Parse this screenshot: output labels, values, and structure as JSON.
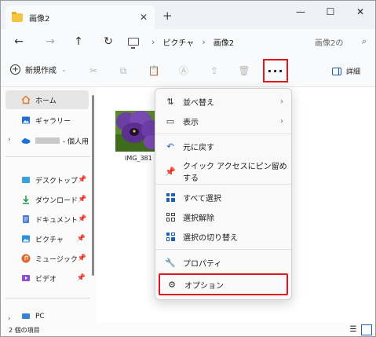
{
  "window": {
    "tab_title": "画像2",
    "tab_close": "✕",
    "new_tab": "+",
    "minimize": "—",
    "maximize": "☐",
    "close": "✕"
  },
  "navbar": {
    "back": "←",
    "forward": "→",
    "up": "↑",
    "refresh": "↻",
    "crumbs": [
      "ピクチャ",
      "画像2"
    ],
    "crumb_sep": "›",
    "search_placeholder": "画像2の",
    "search_icon": "search-icon"
  },
  "toolbar": {
    "new_label": "新規作成",
    "more_label": "···",
    "details_label": "詳細",
    "icons": [
      "cut-icon",
      "copy-icon",
      "paste-icon",
      "rename-icon",
      "share-icon",
      "delete-icon"
    ]
  },
  "sidebar": {
    "items": [
      {
        "label": "ホーム",
        "icon": "home-icon",
        "selected": true
      },
      {
        "label": "ギャラリー",
        "icon": "gallery-icon"
      },
      {
        "label": "- 個人用",
        "icon": "onedrive-icon"
      },
      {
        "label": "デスクトップ",
        "icon": "desktop-icon",
        "pinned": true
      },
      {
        "label": "ダウンロード",
        "icon": "download-icon",
        "pinned": true
      },
      {
        "label": "ドキュメント",
        "icon": "document-icon",
        "pinned": true
      },
      {
        "label": "ピクチャ",
        "icon": "pictures-icon",
        "pinned": true
      },
      {
        "label": "ミュージック",
        "icon": "music-icon",
        "pinned": true
      },
      {
        "label": "ビデオ",
        "icon": "video-icon",
        "pinned": true
      },
      {
        "label": "PC",
        "icon": "pc-icon"
      }
    ]
  },
  "content": {
    "files": [
      {
        "name": "IMG_381",
        "type": "image"
      }
    ]
  },
  "menu": {
    "items": [
      {
        "label": "並べ替え",
        "icon": "sort-icon",
        "submenu": true
      },
      {
        "label": "表示",
        "icon": "view-icon",
        "submenu": true
      },
      {
        "label": "元に戻す",
        "icon": "undo-icon"
      },
      {
        "label": "クイック アクセスにピン留めする",
        "icon": "pin-icon"
      },
      {
        "label": "すべて選択",
        "icon": "select-all-icon"
      },
      {
        "label": "選択解除",
        "icon": "select-none-icon"
      },
      {
        "label": "選択の切り替え",
        "icon": "invert-selection-icon"
      },
      {
        "label": "プロパティ",
        "icon": "properties-icon"
      },
      {
        "label": "オプション",
        "icon": "options-icon",
        "highlighted": true
      }
    ]
  },
  "status": {
    "item_count": "2 個の項目"
  },
  "colors": {
    "highlight_border": "#e0161e",
    "accent": "#1f5fb5",
    "folder": "#f4c443"
  }
}
